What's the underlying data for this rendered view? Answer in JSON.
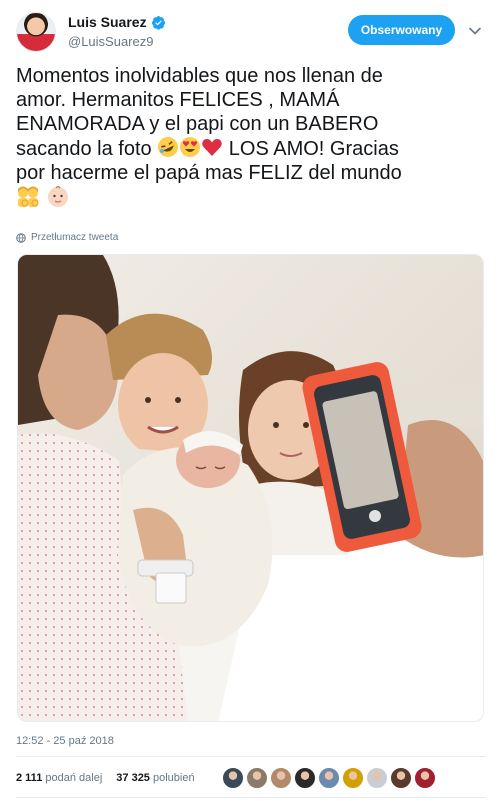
{
  "author": {
    "display_name": "Luis Suarez",
    "handle": "@LuisSuarez9",
    "verified": true
  },
  "follow_button_label": "Obserwowany",
  "tweet": {
    "text_line1": "Momentos inolvidables que nos llenan de",
    "text_line2": "amor. Hermanitos FELICES , MAMÁ",
    "text_line3": "ENAMORADA y el papi con un BABERO",
    "text_line4_before": "sacando la foto ",
    "text_line4_emojis": [
      "rolling-laughing-emoji",
      "heart-eyes-emoji",
      "red-heart-emoji"
    ],
    "text_line4_after": " LOS AMO! Gracias",
    "text_line5": "por hacerme el papá mas FELIZ del mundo",
    "text_line6_emojis": [
      "family-emoji",
      "baby-emoji"
    ]
  },
  "translate_label": "Przetłumacz tweeta",
  "timestamp": "12:52 - 25 paź 2018",
  "stats": {
    "retweets_count": "2 111",
    "retweets_label": "podań dalej",
    "likes_count": "37 325",
    "likes_label": "polubień"
  },
  "liker_avatar_colors": [
    "#3b4a5a",
    "#8a7a6a",
    "#b08a6a",
    "#2a2a2a",
    "#6a8ab0",
    "#d2a000",
    "#c8ced3",
    "#5a3a2a",
    "#a02030"
  ],
  "colors": {
    "accent": "#1da1f2",
    "text": "#14171a",
    "secondary": "#657786"
  }
}
